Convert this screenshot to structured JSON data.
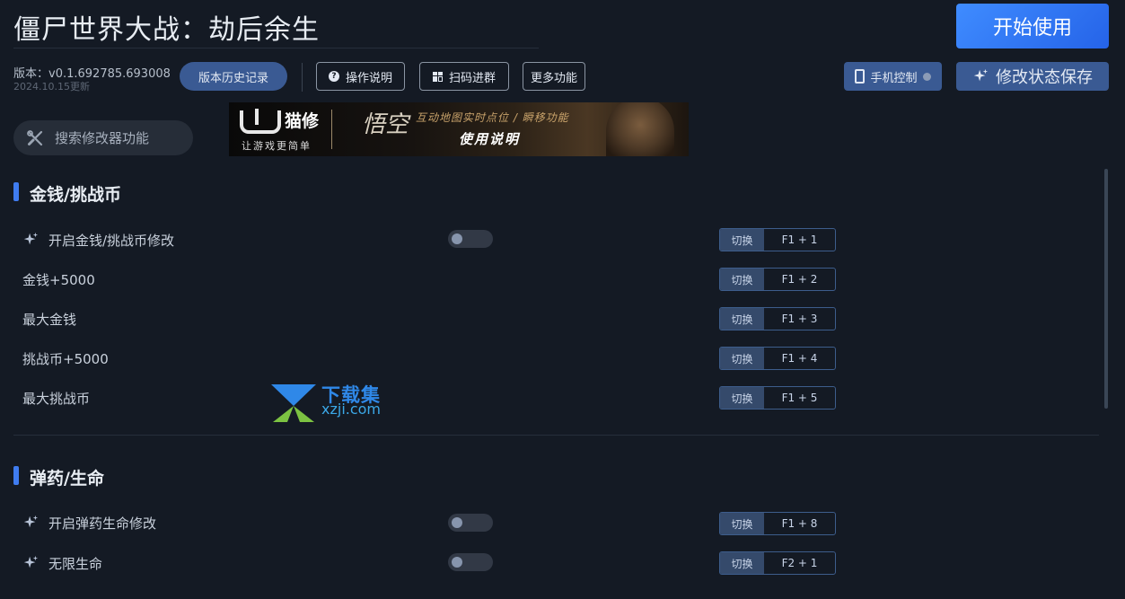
{
  "header": {
    "app_title": "僵尸世界大战：劫后余生",
    "start_button": "开始使用",
    "version": "版本：v0.1.692785.693008",
    "version_date": "2024.10.15更新",
    "history_button": "版本历史记录",
    "help_button": "操作说明",
    "qr_button": "扫码进群",
    "more_button": "更多功能",
    "mobile_button": "手机控制",
    "save_button": "修改状态保存",
    "accent_color": "#3f7cf0"
  },
  "search": {
    "placeholder": "搜索修改器功能"
  },
  "banner": {
    "brand": "猫修",
    "brand_tagline": "让游戏更简单",
    "calligraphy": "悟空",
    "line1": "互动地图实时点位 / 瞬移功能",
    "line2": "使用说明"
  },
  "sections": [
    {
      "title": "金钱/挑战币",
      "rows": [
        {
          "label": "开启金钱/挑战币修改",
          "icon": "sparkle-icon",
          "toggle": false,
          "mode": "切换",
          "hotkey": "F1 + 1"
        },
        {
          "label": "金钱+5000",
          "mode": "切换",
          "hotkey": "F1 + 2"
        },
        {
          "label": "最大金钱",
          "mode": "切换",
          "hotkey": "F1 + 3"
        },
        {
          "label": "挑战币+5000",
          "mode": "切换",
          "hotkey": "F1 + 4"
        },
        {
          "label": "最大挑战币",
          "mode": "切换",
          "hotkey": "F1 + 5"
        }
      ]
    },
    {
      "title": "弹药/生命",
      "rows": [
        {
          "label": "开启弹药生命修改",
          "icon": "sparkle-icon",
          "toggle": false,
          "mode": "切换",
          "hotkey": "F1 + 8"
        },
        {
          "label": "无限生命",
          "icon": "sparkle-icon",
          "toggle": false,
          "mode": "切换",
          "hotkey": "F2 + 1"
        }
      ]
    }
  ],
  "watermark": {
    "line1": "下载集",
    "line2": "xzji.com"
  }
}
